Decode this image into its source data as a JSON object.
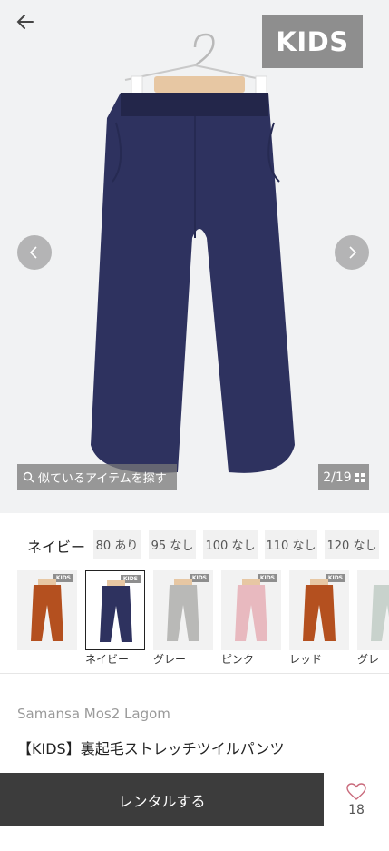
{
  "hero": {
    "badge": "KIDS",
    "similar_label": "似ているアイテムを探す",
    "counter": "2/19"
  },
  "colors": {
    "selected_name": "ネイビー",
    "accent": "#3c3c3c",
    "product_color": "#2e325f"
  },
  "sizes": [
    {
      "label": "80 あり"
    },
    {
      "label": "95 なし"
    },
    {
      "label": "100 なし"
    },
    {
      "label": "110 なし"
    },
    {
      "label": "120 なし"
    }
  ],
  "swatches": [
    {
      "label": "",
      "color": "#b4501f",
      "badge": "KIDS"
    },
    {
      "label": "ネイビー",
      "color": "#2e325f",
      "badge": "KIDS"
    },
    {
      "label": "グレー",
      "color": "#b9b9b7",
      "badge": "KIDS"
    },
    {
      "label": "ピンク",
      "color": "#e8b9bf",
      "badge": "KIDS"
    },
    {
      "label": "レッド",
      "color": "#b4501f",
      "badge": "KIDS"
    },
    {
      "label": "グレ",
      "color": "#c8d2cc",
      "badge": ""
    }
  ],
  "product": {
    "brand": "Samansa Mos2 Lagom",
    "title": "【KIDS】裏起毛ストレッチツイルパンツ"
  },
  "actions": {
    "rent_label": "レンタルする",
    "favorite_count": "18"
  }
}
